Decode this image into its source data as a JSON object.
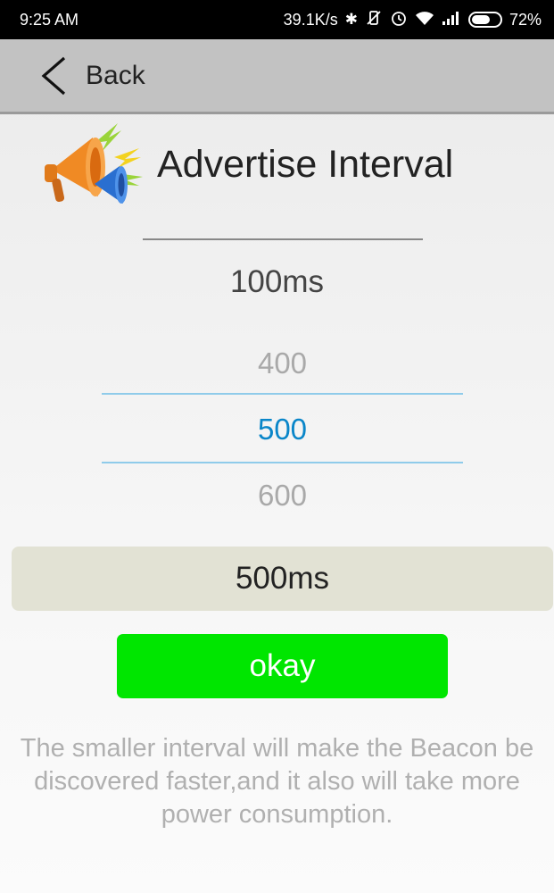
{
  "status_bar": {
    "time": "9:25 AM",
    "network_speed": "39.1K/s",
    "battery_percent": "72%",
    "battery_level": 0.72,
    "icons": [
      "bluetooth-icon",
      "vibrate-icon",
      "alarm-icon",
      "wifi-icon",
      "signal-icon",
      "battery-icon"
    ]
  },
  "header": {
    "back_label": "Back"
  },
  "title": {
    "text": "Advertise Interval",
    "icon": "megaphone-icon"
  },
  "current_value": "100ms",
  "picker": {
    "prev": "400",
    "selected": "500",
    "next": "600"
  },
  "result_value": "500ms",
  "okay_label": "okay",
  "hint": "The smaller interval will make the Beacon be discovered faster,and it also will take more power consumption.",
  "colors": {
    "status_bar_bg": "#000000",
    "header_bg": "#c2c2c2",
    "picker_selected": "#0a86c9",
    "picker_divider": "#8fcbea",
    "result_bg": "#e2e2d4",
    "okay_button_bg": "#00e600",
    "hint_text": "#b0b0b0"
  }
}
